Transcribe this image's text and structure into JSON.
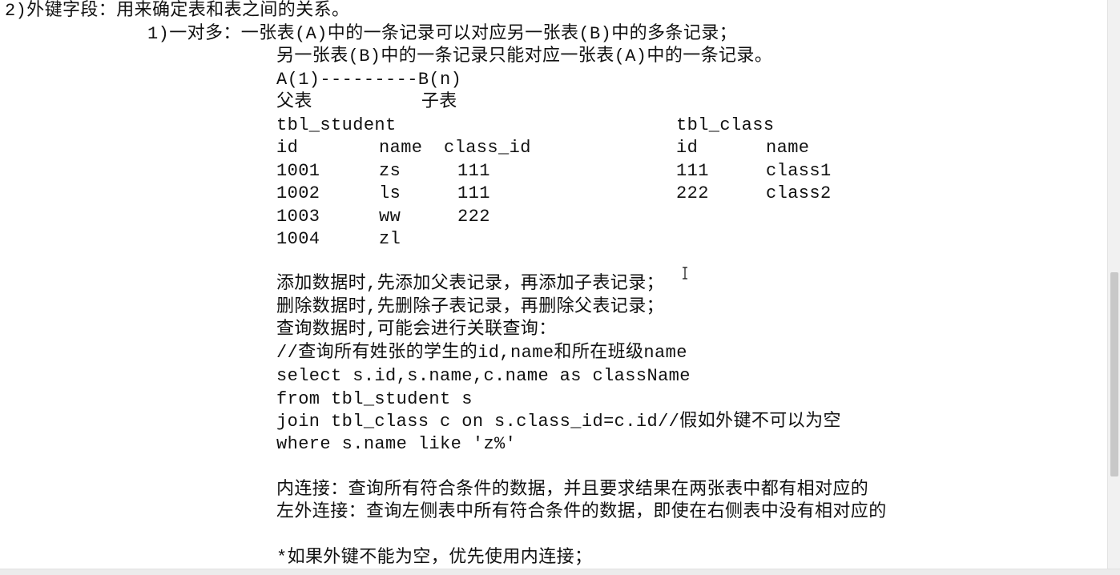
{
  "document": {
    "lines": [
      "2)外键字段：用来确定表和表之间的关系。",
      "1)一对多：一张表(A)中的一条记录可以对应另一张表(B)中的多条记录；",
      "另一张表(B)中的一条记录只能对应一张表(A)中的一条记录。",
      "A(1)---------B(n)",
      "父表          子表",
      "tbl_student",
      "id",
      "name",
      "class_id",
      "1001",
      "zs",
      "111",
      "1002",
      "ls",
      "111",
      "1003",
      "ww",
      "222",
      "1004",
      "zl",
      "tbl_class",
      "id",
      "name",
      "111",
      "class1",
      "222",
      "class2",
      "添加数据时,先添加父表记录，再添加子表记录；",
      "删除数据时,先删除子表记录，再删除父表记录；",
      "查询数据时,可能会进行关联查询：",
      "//查询所有姓张的学生的id,name和所在班级name",
      "select s.id,s.name,c.name as className",
      "from tbl_student s",
      "join tbl_class c on s.class_id=c.id//假如外键不可以为空",
      "where s.name like 'z%'",
      "内连接：查询所有符合条件的数据，并且要求结果在两张表中都有相对应的",
      "左外连接：查询左侧表中所有符合条件的数据，即使在右侧表中没有相对应的",
      "*如果外键不能为空，优先使用内连接；"
    ]
  }
}
